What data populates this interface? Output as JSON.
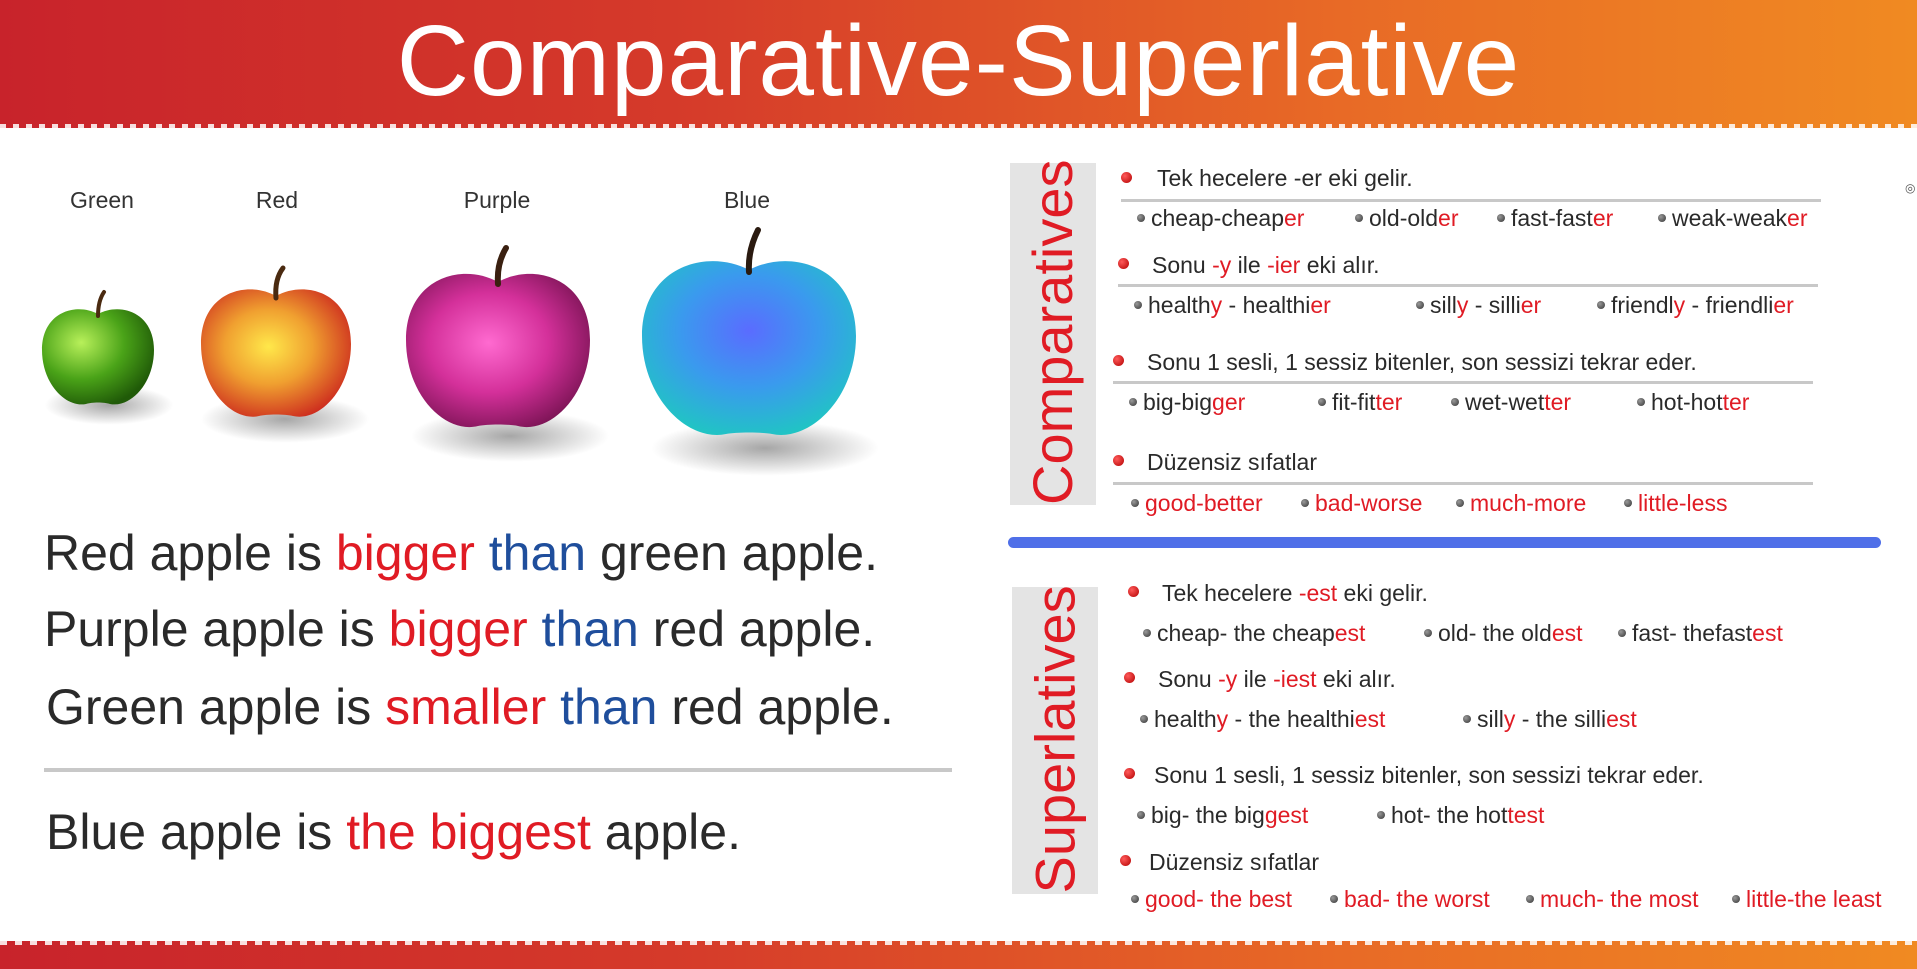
{
  "title": "Comparative-Superlative",
  "apples": {
    "labels": [
      "Green",
      "Red",
      "Purple",
      "Blue"
    ]
  },
  "sentences": [
    {
      "a": "Red apple is ",
      "b": "bigger",
      "c": " than",
      "d": " green apple."
    },
    {
      "a": "Purple apple is ",
      "b": "bigger",
      "c": " than",
      "d": " red apple."
    },
    {
      "a": "Green apple is ",
      "b": "smaller",
      "c": " than",
      "d": " red apple."
    },
    {
      "a": "Blue apple is ",
      "b": "the biggest",
      "c": "",
      "d": " apple."
    }
  ],
  "comparatives": {
    "heading": "Comparatives",
    "rules": [
      {
        "text_a": "Tek hecelere -er eki gelir.",
        "text_b": "",
        "text_c": "",
        "text_d": "",
        "text_e": ""
      },
      {
        "text_a": "Sonu ",
        "text_b": "-y",
        "text_c": " ile ",
        "text_d": "-ier",
        "text_e": " eki alır."
      },
      {
        "text_a": "Sonu 1 sesli, 1 sessiz bitenler, son sessizi tekrar eder.",
        "text_b": "",
        "text_c": "",
        "text_d": "",
        "text_e": ""
      },
      {
        "text_a": "Düzensiz sıfatlar",
        "text_b": "",
        "text_c": "",
        "text_d": "",
        "text_e": ""
      }
    ],
    "examples": [
      [
        [
          "cheap-cheap",
          "er",
          ""
        ],
        [
          "old-old",
          "er",
          ""
        ],
        [
          "fast-fast",
          "er",
          ""
        ],
        [
          "weak-weak",
          "er",
          ""
        ]
      ],
      [
        [
          "health",
          "y",
          " - healthi",
          "er"
        ],
        [
          "sill",
          "y",
          " - silli",
          "er"
        ],
        [
          "friendl",
          "y",
          " - friendli",
          "er"
        ]
      ],
      [
        [
          "big-big",
          "ger",
          ""
        ],
        [
          "fit-fit",
          "ter",
          ""
        ],
        [
          "wet-wet",
          "ter",
          ""
        ],
        [
          "hot-hot",
          "ter",
          ""
        ]
      ],
      [
        [
          "",
          "good-better",
          ""
        ],
        [
          "",
          "bad-worse",
          ""
        ],
        [
          "",
          "much-more",
          ""
        ],
        [
          "",
          "little-less",
          ""
        ]
      ]
    ]
  },
  "superlatives": {
    "heading": "Superlatives",
    "rules": [
      {
        "text_a": "Tek hecelere ",
        "text_b": "-est",
        "text_c": " eki gelir.",
        "text_d": "",
        "text_e": ""
      },
      {
        "text_a": "Sonu ",
        "text_b": "-y",
        "text_c": " ile ",
        "text_d": "-iest",
        "text_e": " eki alır."
      },
      {
        "text_a": "Sonu 1 sesli, 1 sessiz bitenler, son sessizi tekrar eder.",
        "text_b": "",
        "text_c": "",
        "text_d": "",
        "text_e": ""
      },
      {
        "text_a": "Düzensiz sıfatlar",
        "text_b": "",
        "text_c": "",
        "text_d": "",
        "text_e": ""
      }
    ],
    "examples": [
      [
        [
          "cheap- the cheap",
          "est",
          ""
        ],
        [
          "old- the old",
          "est",
          ""
        ],
        [
          "fast- thefast",
          "est",
          ""
        ]
      ],
      [
        [
          "health",
          "y",
          " - the healthi",
          "est"
        ],
        [
          "sill",
          "y",
          " - the silli",
          "est"
        ]
      ],
      [
        [
          "big- the big",
          "gest",
          ""
        ],
        [
          "hot- the hot",
          "test",
          ""
        ]
      ],
      [
        [
          "",
          "good- the best",
          ""
        ],
        [
          "",
          "bad- the worst",
          ""
        ],
        [
          "",
          "much- the most",
          ""
        ],
        [
          "",
          "little-the least",
          ""
        ]
      ]
    ]
  },
  "colors": {
    "accent_red": "#e01b24",
    "than_blue": "#1f4e9c",
    "separator_blue": "#4f6fe8"
  }
}
